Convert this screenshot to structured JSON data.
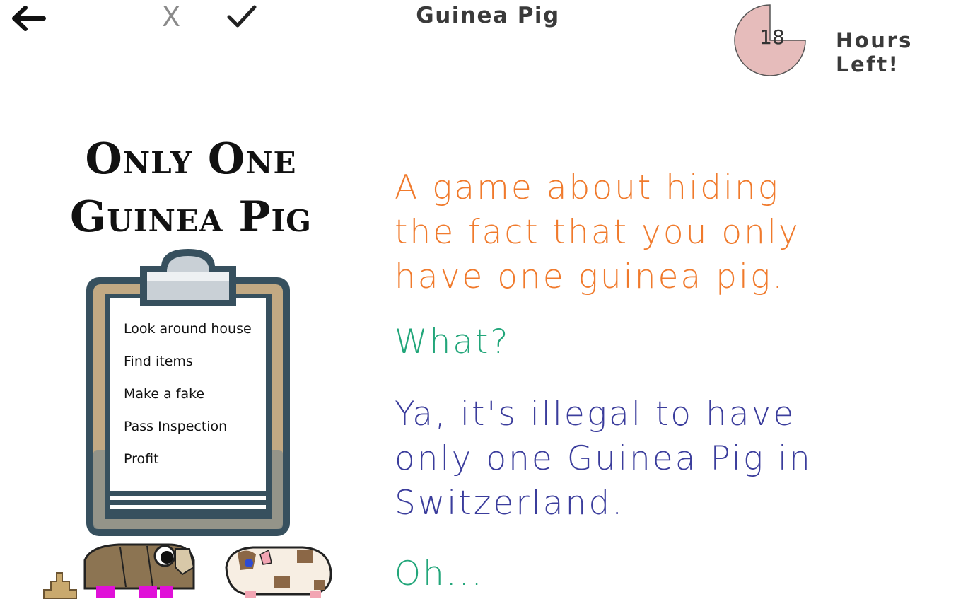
{
  "header": {
    "title": "Guinea Pig",
    "close_label": "X",
    "timer_value": "18",
    "timer_fraction_remaining": 0.75,
    "hours_left_label": "Hours Left!"
  },
  "logo": {
    "line1": "Only One",
    "line2": "Guinea Pig"
  },
  "clipboard": {
    "tasks": [
      "Look around house",
      "Find items",
      "Make a fake",
      "Pass Inspection",
      "Profit"
    ]
  },
  "dialogue": {
    "orange": [
      "A game about hiding",
      "the fact that you only",
      "have one guinea pig."
    ],
    "green1": "What?",
    "purple": [
      "Ya, it's illegal to have",
      "only one Guinea Pig in",
      "Switzerland."
    ],
    "green2": "Oh..."
  },
  "colors": {
    "orange": "#f07a2c",
    "green": "#22a67a",
    "purple": "#3b3d9c",
    "timer_fill": "#e6bcbb",
    "clipboard_frame": "#37505e",
    "clipboard_board": "#c2a983"
  },
  "icons": {
    "back": "arrow-left-icon",
    "check": "check-icon",
    "timer": "pie-timer-icon"
  }
}
